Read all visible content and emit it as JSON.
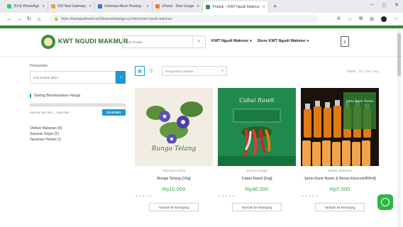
{
  "browser": {
    "tabs": [
      {
        "label": "(514) WhatsApp",
        "color": "#25d366"
      },
      {
        "label": "502 Bad Gateway",
        "color": "#e8a23a"
      },
      {
        "label": "Informasi Akun Hosting -",
        "color": "#3a6fd6"
      },
      {
        "label": "cPanel - Disk Usage",
        "color": "#f07b1e"
      },
      {
        "label": "Produk – KWT Ngudi Makmur",
        "color": "#3c8d3c"
      }
    ],
    "url": "https://kwtngudimakmur05kelurahanjogja.xyz/store-kwt-ngudi-makmur/"
  },
  "header": {
    "brand": "KWT NGUDI MAKMUR",
    "search_placeholder": "Cari Produk",
    "menu": [
      "KWT Ngudi Makmur",
      "Store KWT Ngudi Makmur"
    ],
    "cart_count": "0"
  },
  "sidebar": {
    "search_title": "Pencarian",
    "search_placeholder": "Cari produk disini",
    "filter_title": "Saring Berdasarkan Harga",
    "price_range": "HARGA: Rp7,000 — Rp40,000",
    "filter_button": "SARING",
    "categories": [
      "Olahan Makanan (6)",
      "Sayuran Segar (5)",
      "Tanaman Herbal (1)"
    ]
  },
  "toolbar": {
    "sort_label": "Pengurutan standar",
    "view_count": "VIEW : 12 / 24 / ALL"
  },
  "products": [
    {
      "category": "Tanaman Herba",
      "name": "Bunga Telang [10g]",
      "price": "Rp10.000",
      "button": "Tambah ke keranjang",
      "image_text": "Bunga Telang"
    },
    {
      "category": "Sayuran Segar",
      "name": "Cabai Rawit [1kg]",
      "price": "Rp40.000",
      "button": "Tambah ke keranjang",
      "image_text": "Cabai Rawit"
    },
    {
      "category": "Olahan Makanan",
      "name": "Jamu Kunir Asem & Beras Kencur[450ml]",
      "price": "Rp7.000",
      "button": "Tambah ke keranjang",
      "image_text": "Jamu Kunir Asem"
    }
  ],
  "colors": {
    "accent": "#2196d3",
    "brand_green": "#2f8a2f",
    "price_green": "#3aa84f"
  }
}
